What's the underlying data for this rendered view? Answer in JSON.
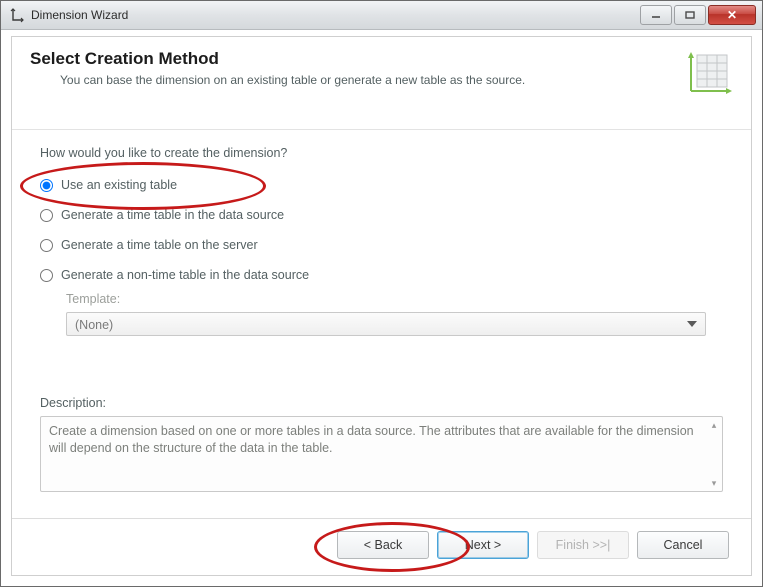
{
  "titlebar": {
    "title": "Dimension Wizard"
  },
  "header": {
    "title": "Select Creation Method",
    "subtitle": "You can base the dimension on an existing table or generate a new table as the source."
  },
  "content": {
    "question": "How would you like to create the dimension?",
    "options": {
      "existing": "Use an existing table",
      "time_source": "Generate a time table in the data source",
      "time_server": "Generate a time table on the server",
      "nontime": "Generate a non-time table in the data source"
    },
    "template_label": "Template:",
    "template_value": "(None)",
    "description_label": "Description:",
    "description_text": "Create a dimension based on one or more tables in a data source. The attributes that are available for the dimension will depend on the structure of the data in the table."
  },
  "buttons": {
    "back": "< Back",
    "next": "Next >",
    "finish": "Finish >>|",
    "cancel": "Cancel"
  }
}
